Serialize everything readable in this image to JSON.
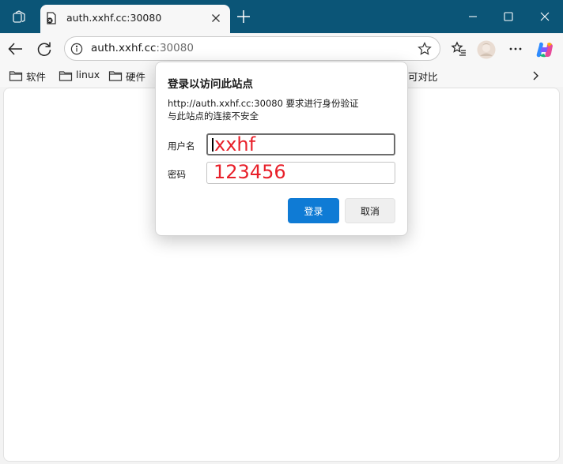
{
  "tab": {
    "title": "auth.xxhf.cc:30080"
  },
  "address": {
    "host": "auth.xxhf.cc",
    "port": ":30080"
  },
  "bookmarks": {
    "items": [
      {
        "label": "软件"
      },
      {
        "label": "linux"
      },
      {
        "label": "硬件"
      }
    ],
    "partial_label": "可对比"
  },
  "dialog": {
    "title": "登录以访问此站点",
    "message_line1": "http://auth.xxhf.cc:30080 要求进行身份验证",
    "message_line2": "与此站点的连接不安全",
    "username_label": "用户名",
    "password_label": "密码",
    "username_value": "xxhf",
    "password_value": "123456",
    "login_label": "登录",
    "cancel_label": "取消"
  },
  "colors": {
    "titlebar": "#0b5577",
    "accent": "#0f7bd5",
    "annotation_text": "#e8202a"
  },
  "icons": [
    "tab-actions-icon",
    "tab-favicon-icon",
    "close-icon",
    "plus-icon",
    "minimize-icon",
    "maximize-icon",
    "window-close-icon",
    "back-arrow-icon",
    "refresh-icon",
    "info-icon",
    "star-icon",
    "favorites-icon",
    "profile-avatar-icon",
    "more-icon",
    "copilot-icon",
    "folder-icon",
    "chevron-right-icon"
  ]
}
